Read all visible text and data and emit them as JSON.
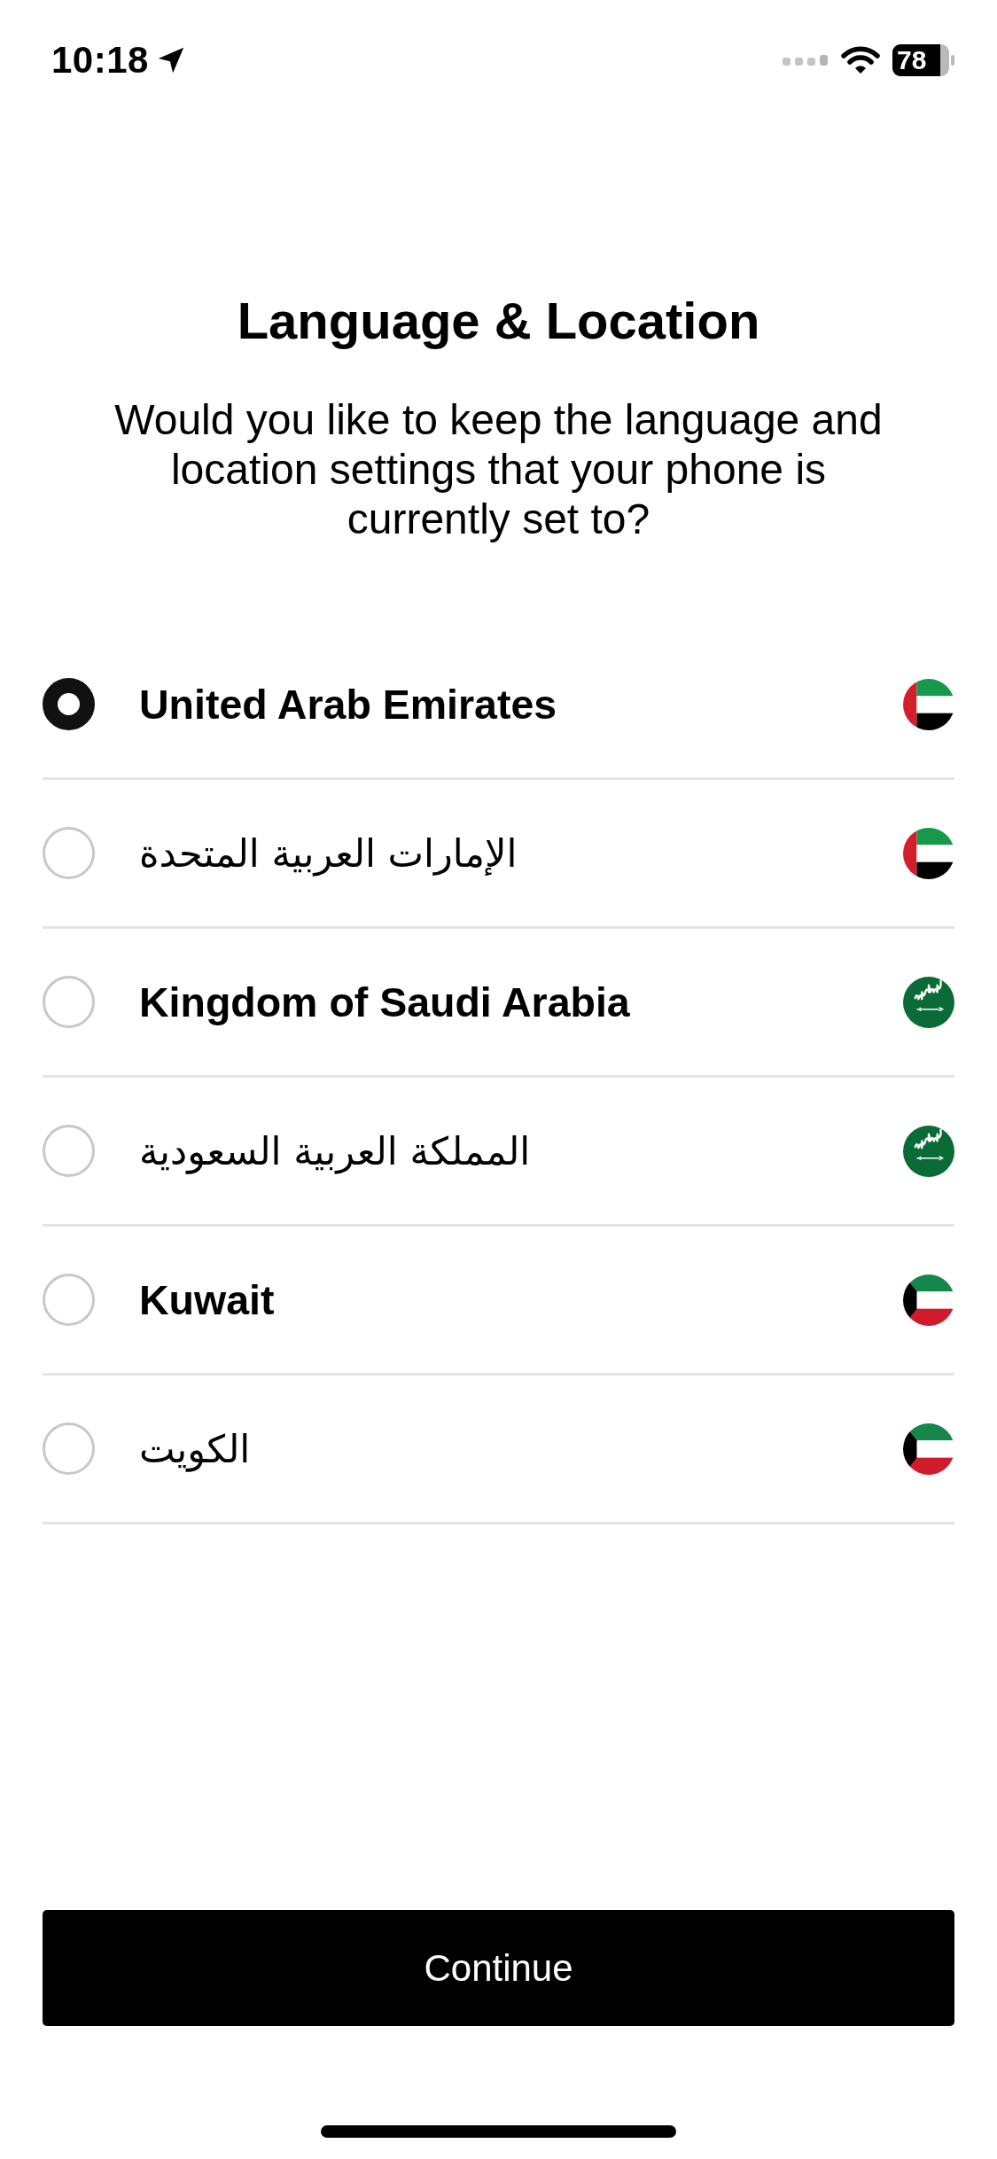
{
  "status_bar": {
    "time": "10:18",
    "battery": "78"
  },
  "title": "Language & Location",
  "subtitle": "Would you like to keep the language and location settings that your phone is currently set to?",
  "options": [
    {
      "label": "United Arab Emirates",
      "rtl": false,
      "kind": "uae",
      "selected": true
    },
    {
      "label": "الإمارات العربية المتحدة",
      "rtl": true,
      "kind": "uae",
      "selected": false
    },
    {
      "label": "Kingdom of Saudi Arabia",
      "rtl": false,
      "kind": "saudi",
      "selected": false
    },
    {
      "label": "المملكة العربية السعودية",
      "rtl": true,
      "kind": "saudi",
      "selected": false
    },
    {
      "label": "Kuwait",
      "rtl": false,
      "kind": "kuwait",
      "selected": false
    },
    {
      "label": "الكويت",
      "rtl": true,
      "kind": "kuwait",
      "selected": false
    }
  ],
  "button": "Continue"
}
